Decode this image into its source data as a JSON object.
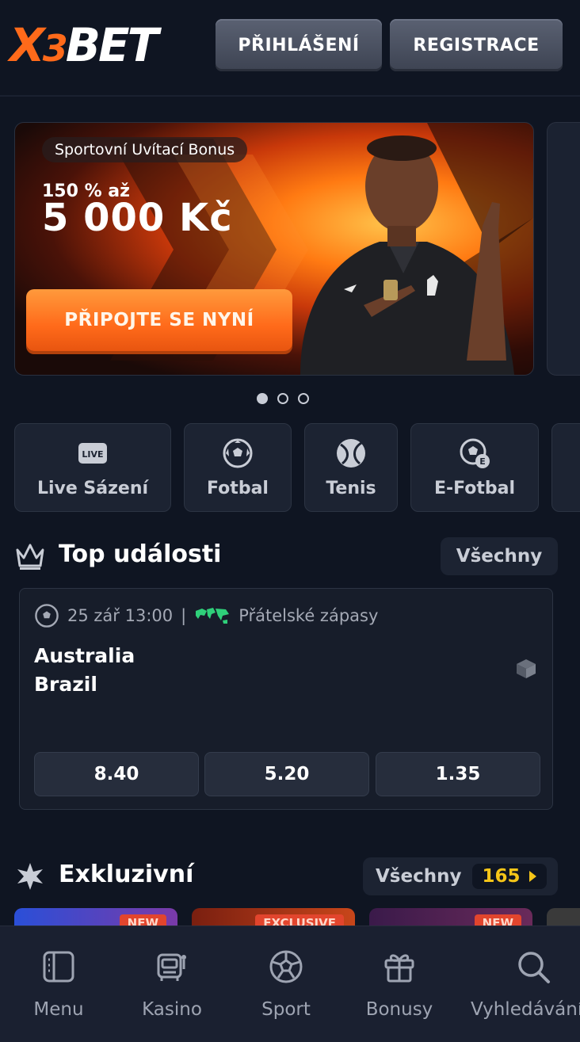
{
  "header": {
    "logo_text": "X3BET",
    "login_label": "PŘIHLÁŠENÍ",
    "register_label": "REGISTRACE"
  },
  "banner": {
    "pill": "Sportovní Uvítací Bonus",
    "sub": "150 % až",
    "amount": "5 000 Kč",
    "cta": "PŘIPOJTE SE NYNÍ",
    "slides_total": 3,
    "active_slide": 1
  },
  "categories": [
    {
      "label": "Live Sázení",
      "icon": "live-icon"
    },
    {
      "label": "Fotbal",
      "icon": "football-icon"
    },
    {
      "label": "Tenis",
      "icon": "tennis-icon"
    },
    {
      "label": "E-Fotbal",
      "icon": "efootball-icon"
    }
  ],
  "top_events": {
    "title": "Top události",
    "all_label": "Všechny",
    "event": {
      "datetime": "25 zář 13:00",
      "separator": "|",
      "league": "Přátelské zápasy",
      "team1": "Australia",
      "team2": "Brazil",
      "odds": [
        "8.40",
        "5.20",
        "1.35"
      ]
    }
  },
  "exclusive": {
    "title": "Exkluzivní",
    "all_label": "Všechny",
    "count": "165",
    "badges": [
      "NEW",
      "EXCLUSIVE",
      "NEW"
    ]
  },
  "bottom_nav": [
    {
      "label": "Menu",
      "icon": "menu-icon"
    },
    {
      "label": "Kasino",
      "icon": "slot-machine-icon"
    },
    {
      "label": "Sport",
      "icon": "football-icon"
    },
    {
      "label": "Bonusy",
      "icon": "gift-icon"
    },
    {
      "label": "Vyhledávání",
      "icon": "search-icon"
    }
  ],
  "colors": {
    "background": "#0f1522",
    "accent_orange": "#ff6a1a",
    "count_yellow": "#f5c518"
  }
}
